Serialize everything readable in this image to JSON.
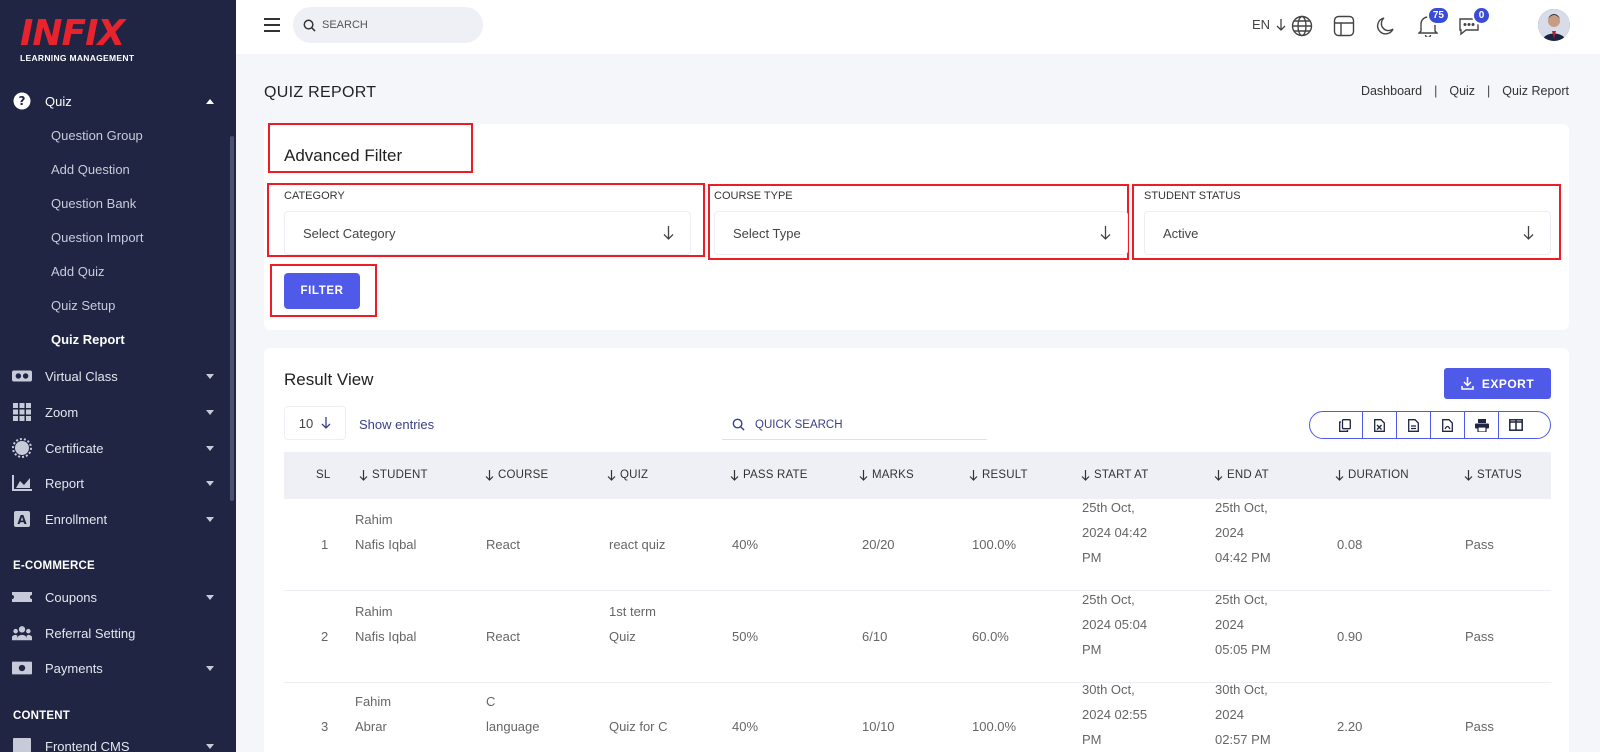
{
  "sidebar": {
    "logo": "INFIX",
    "logo_sub": "LEARNING MANAGEMENT",
    "quiz": {
      "label": "Quiz",
      "items": [
        "Question Group",
        "Add Question",
        "Question Bank",
        "Question Import",
        "Add Quiz",
        "Quiz Setup",
        "Quiz Report"
      ]
    },
    "nav": [
      "Virtual Class",
      "Zoom",
      "Certificate",
      "Report",
      "Enrollment"
    ],
    "ecommerce_head": "E-COMMERCE",
    "ecommerce": [
      "Coupons",
      "Referral Setting",
      "Payments"
    ],
    "content_head": "CONTENT",
    "content": [
      "Frontend CMS"
    ]
  },
  "header": {
    "search_placeholder": "SEARCH",
    "lang": "EN",
    "notif_count": "75",
    "msg_count": "0"
  },
  "page": {
    "title": "QUIZ REPORT",
    "breadcrumb": [
      "Dashboard",
      "Quiz",
      "Quiz Report"
    ]
  },
  "filter": {
    "title": "Advanced Filter",
    "category_label": "CATEGORY",
    "category_value": "Select Category",
    "course_type_label": "COURSE TYPE",
    "course_type_value": "Select Type",
    "status_label": "STUDENT STATUS",
    "status_value": "Active",
    "button": "FILTER"
  },
  "result": {
    "title": "Result View",
    "export": "EXPORT",
    "entries": "10",
    "show_entries": "Show entries",
    "quick_search": "QUICK SEARCH",
    "columns": [
      "SL",
      "STUDENT",
      "COURSE",
      "QUIZ",
      "PASS RATE",
      "MARKS",
      "RESULT",
      "START AT",
      "END AT",
      "DURATION",
      "STATUS"
    ],
    "rows": [
      {
        "sl": "1",
        "student": [
          "Rahim",
          "Nafis Iqbal"
        ],
        "course": [
          "React"
        ],
        "quiz": [
          "react quiz"
        ],
        "pass_rate": "40%",
        "marks": "20/20",
        "result": "100.0%",
        "start": [
          "25th Oct,",
          "2024 04:42",
          "PM"
        ],
        "end": [
          "25th Oct,",
          "2024",
          "04:42 PM"
        ],
        "duration": "0.08",
        "status": "Pass"
      },
      {
        "sl": "2",
        "student": [
          "Rahim",
          "Nafis Iqbal"
        ],
        "course": [
          "React"
        ],
        "quiz": [
          "1st term",
          "Quiz"
        ],
        "pass_rate": "50%",
        "marks": "6/10",
        "result": "60.0%",
        "start": [
          "25th Oct,",
          "2024 05:04",
          "PM"
        ],
        "end": [
          "25th Oct,",
          "2024",
          "05:05 PM"
        ],
        "duration": "0.90",
        "status": "Pass"
      },
      {
        "sl": "3",
        "student": [
          "Fahim",
          "Abrar"
        ],
        "course": [
          "C",
          "language"
        ],
        "quiz": [
          "Quiz for C"
        ],
        "pass_rate": "40%",
        "marks": "10/10",
        "result": "100.0%",
        "start": [
          "30th Oct,",
          "2024 02:55",
          "PM"
        ],
        "end": [
          "30th Oct,",
          "2024",
          "02:57 PM"
        ],
        "duration": "2.20",
        "status": "Pass"
      }
    ]
  }
}
